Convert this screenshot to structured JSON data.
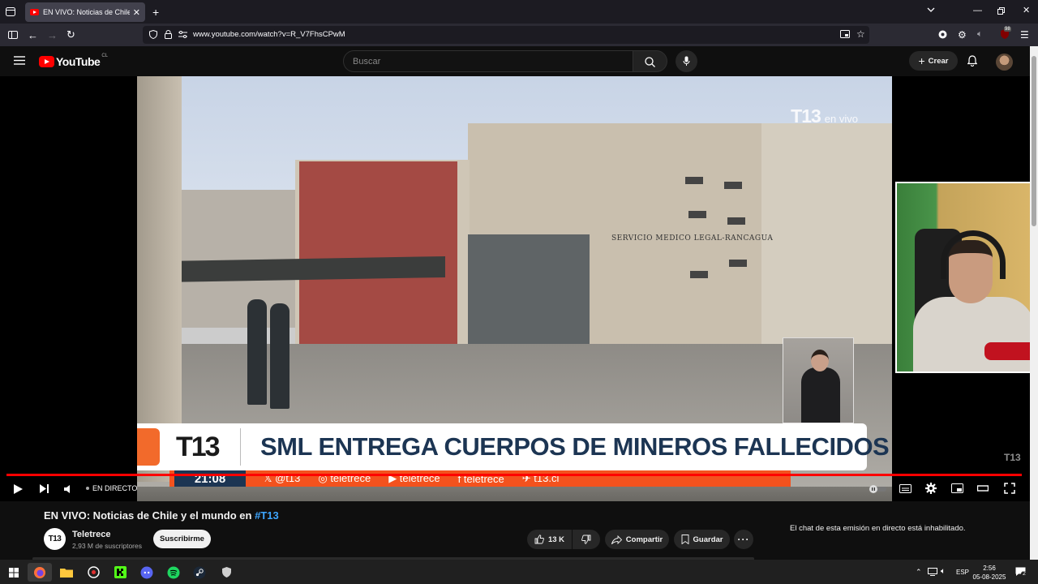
{
  "browser": {
    "tab_title": "EN VIVO: Noticias de Chile y el",
    "url": "www.youtube.com/watch?v=R_V7FhsCPwM",
    "notif_badge": "98"
  },
  "youtube": {
    "logo_text": "YouTube",
    "country": "CL",
    "search_placeholder": "Buscar",
    "create_label": "Crear"
  },
  "player": {
    "watermark": "T13",
    "watermark_sub": "en vivo",
    "lower_third_logo": "T13",
    "headline": "SML ENTREGA CUERPOS DE MINEROS FALLECIDOS",
    "on_screen_time": "21:08",
    "ticker": [
      "𝕏 @t13",
      "◎ teletrece",
      "▶ teletrece",
      "f teletrece",
      "✈ t13.cl"
    ],
    "building_sign": "SERVICIO MEDICO LEGAL-RANCAGUA",
    "corner_logo": "T13",
    "live_label": "EN DIRECTO",
    "progress": 1.0
  },
  "video": {
    "title_main": "EN VIVO: Noticias de Chile y el mundo en ",
    "title_tag": "#T13",
    "channel_name": "Teletrece",
    "channel_avatar_text": "T13",
    "subscribers": "2,93 M de suscriptores",
    "subscribe_label": "Suscribirme",
    "likes": "13 K",
    "share_label": "Compartir",
    "save_label": "Guardar"
  },
  "chat": {
    "disabled_message": "El chat de esta emisión en directo está inhabilitado."
  },
  "taskbar": {
    "language": "ESP",
    "time": "2:56",
    "date": "05-08-2025",
    "notification_count": "2"
  }
}
